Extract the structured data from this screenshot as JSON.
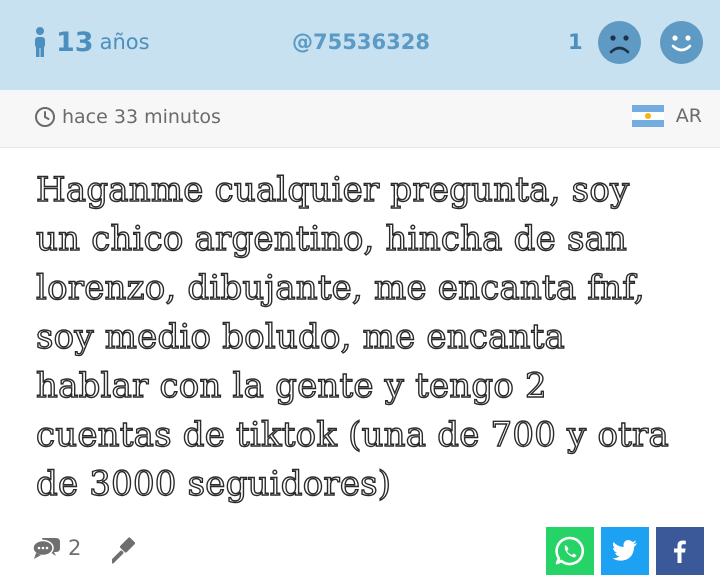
{
  "header": {
    "age_number": "13",
    "age_unit": "años",
    "username": "@75536328",
    "vote_count": "1",
    "icons": {
      "age": "person-icon",
      "dislike": "sad-face-icon",
      "like": "happy-face-icon"
    },
    "colors": {
      "bar": "#c8e1f0",
      "accent": "#5e9ac3"
    }
  },
  "meta": {
    "time": "hace 33 minutos",
    "country_code": "AR",
    "icons": {
      "time": "clock-icon",
      "flag": "argentina-flag-icon"
    }
  },
  "question": {
    "lines": [
      "Haganme cualquier pregunta, soy",
      "un chico argentino, hincha de san",
      "lorenzo, dibujante, me encanta fnf,",
      "soy medio boludo, me encanta",
      "hablar con la gente y tengo 2",
      "cuentas de tiktok (una de 700 y otra",
      "de 3000 seguidores)"
    ]
  },
  "footer": {
    "answer_count": "2",
    "icons": {
      "answers": "comment-bubbles-icon",
      "report": "gavel-icon",
      "whatsapp": "whatsapp-icon",
      "twitter": "twitter-icon",
      "facebook": "facebook-icon"
    },
    "colors": {
      "whatsapp": "#25d366",
      "twitter": "#1da1f2",
      "facebook": "#3b5998"
    }
  }
}
